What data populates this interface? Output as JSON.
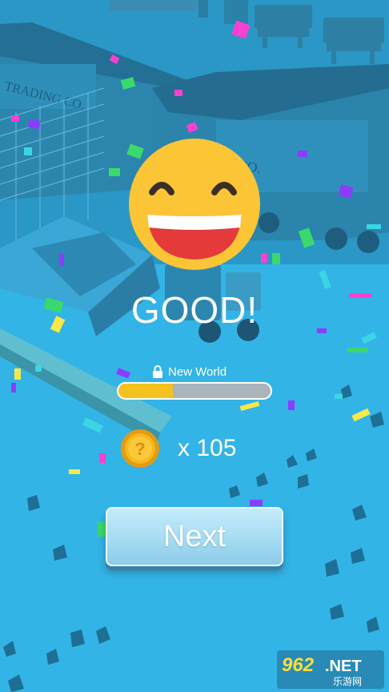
{
  "result": {
    "title": "GOOD!"
  },
  "progress": {
    "label": "New World",
    "fraction": 0.36
  },
  "reward": {
    "coins": "x 105"
  },
  "buttons": {
    "next_label": "Next"
  },
  "scene": {
    "sign_left": "TRADING CO.",
    "sign_right": "CO."
  },
  "watermark": {
    "number": "962",
    "suffix": ".NET",
    "subtitle": "乐游网"
  },
  "colors": {
    "background": "#2fb0e2",
    "progress_fill": "#f4c21c",
    "progress_track": "#a9b4bd",
    "emoji_face": "#fcc536",
    "emoji_mouth": "#e43a3a",
    "coin": "#f6b81d",
    "button": "#a6dcf3"
  },
  "icons": {
    "emoji": "grinning-face-icon",
    "lock": "lock-icon",
    "coin": "question-coin-icon"
  }
}
